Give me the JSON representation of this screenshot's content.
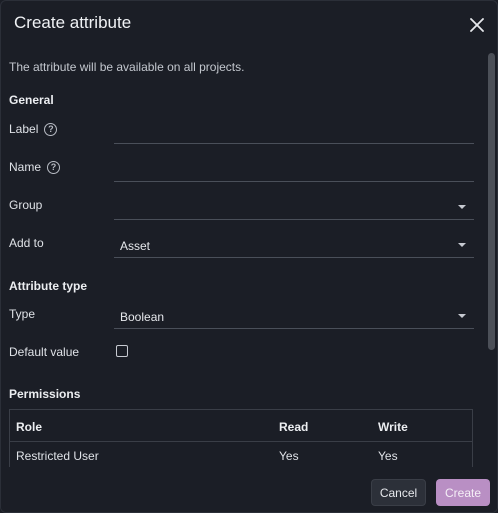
{
  "dialog": {
    "title": "Create attribute",
    "close_icon": "close-icon"
  },
  "description": "The attribute will be available on all projects.",
  "general": {
    "section_title": "General",
    "label_field": {
      "label": "Label",
      "value": "",
      "help_icon": "help-circle-icon"
    },
    "name_field": {
      "label": "Name",
      "value": "",
      "help_icon": "help-circle-icon"
    },
    "group_field": {
      "label": "Group",
      "value": ""
    },
    "add_to_field": {
      "label": "Add to",
      "value": "Asset"
    }
  },
  "attribute_type": {
    "section_title": "Attribute type",
    "type_field": {
      "label": "Type",
      "value": "Boolean"
    },
    "default_value": {
      "label": "Default value",
      "checked": false
    }
  },
  "permissions": {
    "section_title": "Permissions",
    "columns": [
      "Role",
      "Read",
      "Write"
    ],
    "rows": [
      {
        "role": "Restricted User",
        "read": "Yes",
        "write": "Yes"
      }
    ]
  },
  "footer": {
    "cancel_label": "Cancel",
    "create_label": "Create"
  },
  "colors": {
    "background": "#1b1e26",
    "accent": "#b98fc4"
  }
}
